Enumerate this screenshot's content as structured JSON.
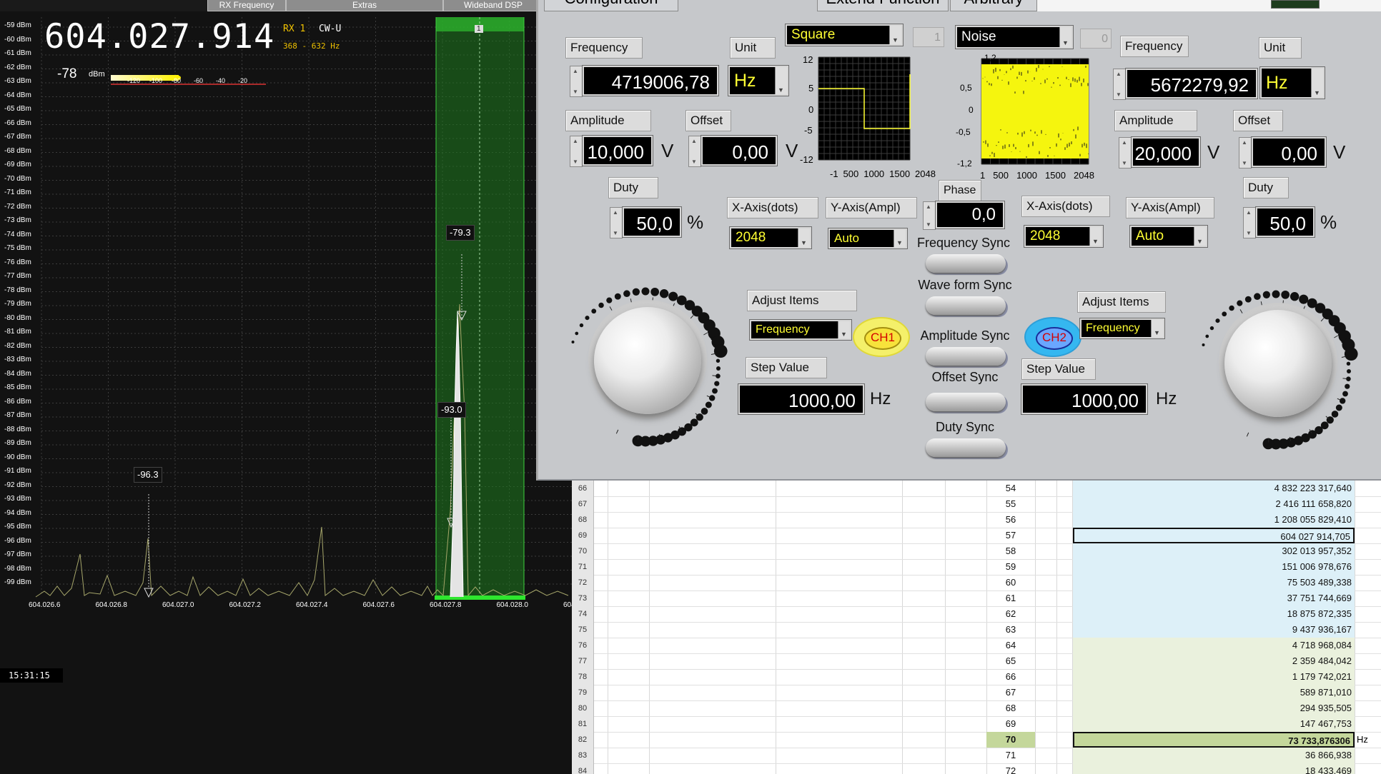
{
  "sdr": {
    "tabs": [
      "RX Frequency",
      "Extras",
      "Wideband DSP"
    ],
    "vfo_frequency": "604.027.914",
    "rx_label": "RX 1",
    "mode": "CW-U",
    "filter_range": "368 - 632 Hz",
    "signal_level": "-78",
    "signal_unit": "dBm",
    "smeter_scale": [
      "-120",
      "-100",
      "-80",
      "-60",
      "-40",
      "-20"
    ],
    "smeter_level_fraction": 0.52,
    "dbm_scale": [
      "-59 dBm",
      "-60 dBm",
      "-61 dBm",
      "-62 dBm",
      "-63 dBm",
      "-64 dBm",
      "-65 dBm",
      "-66 dBm",
      "-67 dBm",
      "-68 dBm",
      "-69 dBm",
      "-70 dBm",
      "-71 dBm",
      "-72 dBm",
      "-73 dBm",
      "-74 dBm",
      "-75 dBm",
      "-76 dBm",
      "-77 dBm",
      "-78 dBm",
      "-79 dBm",
      "-80 dBm",
      "-81 dBm",
      "-82 dBm",
      "-83 dBm",
      "-84 dBm",
      "-85 dBm",
      "-86 dBm",
      "-87 dBm",
      "-88 dBm",
      "-89 dBm",
      "-90 dBm",
      "-91 dBm",
      "-92 dBm",
      "-93 dBm",
      "-94 dBm",
      "-95 dBm",
      "-96 dBm",
      "-97 dBm",
      "-98 dBm",
      "-99 dBm"
    ],
    "freq_axis": [
      "604.026.6",
      "604.026.8",
      "604.027.0",
      "604.027.2",
      "604.027.4",
      "604.027.6",
      "604.027.8",
      "604.028.0",
      "604"
    ],
    "rx_marker": "1",
    "peaks": [
      "-79.3",
      "-93.0",
      "-96.3"
    ],
    "waterfall_time": "15:31:15"
  },
  "siggen": {
    "tabs": [
      "Configuration",
      "Extend Function",
      "Arbitrary"
    ],
    "ch1": {
      "waveform": "Square",
      "waveform_index": "1",
      "frequency_label": "Frequency",
      "frequency": "4719006,78",
      "unit_label": "Unit",
      "unit": "Hz",
      "amplitude_label": "Amplitude",
      "amplitude": "10,000",
      "amplitude_unit": "V",
      "offset_label": "Offset",
      "offset": "0,00",
      "offset_unit": "V",
      "duty_label": "Duty",
      "duty": "50,0",
      "duty_unit": "%",
      "xaxis_label": "X-Axis(dots)",
      "xaxis": "2048",
      "yaxis_label": "Y-Axis(Ampl)",
      "yaxis": "Auto",
      "adjust_label": "Adjust Items",
      "adjust": "Frequency",
      "step_label": "Step Value",
      "step": "1000,00",
      "step_unit": "Hz",
      "button": "CH1",
      "plot_y_ticks": [
        "12",
        "5",
        "0",
        "-5",
        "-12"
      ],
      "plot_x_ticks": [
        "-1",
        "500",
        "1000",
        "1500",
        "2048"
      ]
    },
    "ch2": {
      "waveform": "Noise",
      "waveform_index": "0",
      "frequency_label": "Frequency",
      "frequency": "5672279,92",
      "unit_label": "Unit",
      "unit": "Hz",
      "amplitude_label": "Amplitude",
      "amplitude": "20,000",
      "amplitude_unit": "V",
      "offset_label": "Offset",
      "offset": "0,00",
      "offset_unit": "V",
      "duty_label": "Duty",
      "duty": "50,0",
      "duty_unit": "%",
      "xaxis_label": "X-Axis(dots)",
      "xaxis": "2048",
      "yaxis_label": "Y-Axis(Ampl)",
      "yaxis": "Auto",
      "adjust_label": "Adjust Items",
      "adjust": "Frequency",
      "step_label": "Step Value",
      "step": "1000,00",
      "step_unit": "Hz",
      "button": "CH2",
      "plot_y_ticks": [
        "1,2",
        "0,5",
        "0",
        "-0,5",
        "-1,2"
      ],
      "plot_x_ticks": [
        "1",
        "500",
        "1000",
        "1500",
        "2048"
      ]
    },
    "phase_label": "Phase",
    "phase": "0,0",
    "sync": [
      "Frequency Sync",
      "Wave form Sync",
      "Amplitude Sync",
      "Offset Sync",
      "Duty Sync"
    ]
  },
  "sheet": {
    "rows": [
      {
        "row": "66",
        "n": "54",
        "value": "4 832 223 317,640"
      },
      {
        "row": "67",
        "n": "55",
        "value": "2 416 111 658,820"
      },
      {
        "row": "68",
        "n": "56",
        "value": "1 208 055 829,410"
      },
      {
        "row": "69",
        "n": "57",
        "value": "604 027 914,705"
      },
      {
        "row": "70",
        "n": "58",
        "value": "302 013 957,352"
      },
      {
        "row": "71",
        "n": "59",
        "value": "151 006 978,676"
      },
      {
        "row": "72",
        "n": "60",
        "value": "75 503 489,338"
      },
      {
        "row": "73",
        "n": "61",
        "value": "37 751 744,669"
      },
      {
        "row": "74",
        "n": "62",
        "value": "18 875 872,335"
      },
      {
        "row": "75",
        "n": "63",
        "value": "9 437 936,167"
      },
      {
        "row": "76",
        "n": "64",
        "value": "4 718 968,084"
      },
      {
        "row": "77",
        "n": "65",
        "value": "2 359 484,042"
      },
      {
        "row": "78",
        "n": "66",
        "value": "1 179 742,021"
      },
      {
        "row": "79",
        "n": "67",
        "value": "589 871,010"
      },
      {
        "row": "80",
        "n": "68",
        "value": "294 935,505"
      },
      {
        "row": "81",
        "n": "69",
        "value": "147 467,753"
      },
      {
        "row": "82",
        "n": "70",
        "value": "73 733,876306"
      },
      {
        "row": "83",
        "n": "71",
        "value": "36 866,938"
      },
      {
        "row": "84",
        "n": "72",
        "value": "18 433,469"
      }
    ],
    "highlight_unit": "Hz",
    "colors": {
      "blue": "#ddf0f8",
      "green": "#eaf1dd",
      "highlight": "#c4d79b"
    }
  }
}
